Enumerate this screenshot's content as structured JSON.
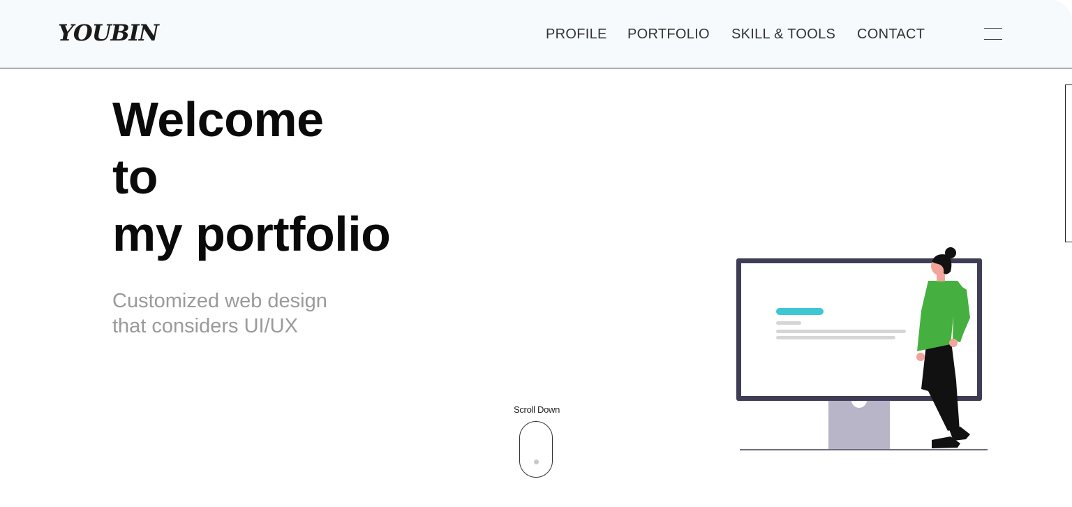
{
  "header": {
    "logo": "YOUBIN",
    "nav": [
      {
        "label": "PROFILE"
      },
      {
        "label": "PORTFOLIO"
      },
      {
        "label": "SKILL & TOOLS"
      },
      {
        "label": "CONTACT"
      }
    ],
    "menu_icon": "hamburger-menu-icon"
  },
  "hero": {
    "title_lines": [
      "Welcome",
      "to",
      "my portfolio"
    ],
    "subtitle_lines": [
      "Customized web design",
      "that considers UI/UX"
    ]
  },
  "scroll": {
    "label": "Scroll Down",
    "icon": "mouse-scroll-icon"
  },
  "illustration": {
    "icon": "person-presenting-monitor-illustration",
    "colors": {
      "monitor_frame": "#3f3d56",
      "stand": "#b8b5c8",
      "accent_bar": "#3ec6d4",
      "shirt": "#45b03f",
      "pants": "#111111",
      "skin": "#f2a49a",
      "lines": "#d6d6d6"
    }
  }
}
